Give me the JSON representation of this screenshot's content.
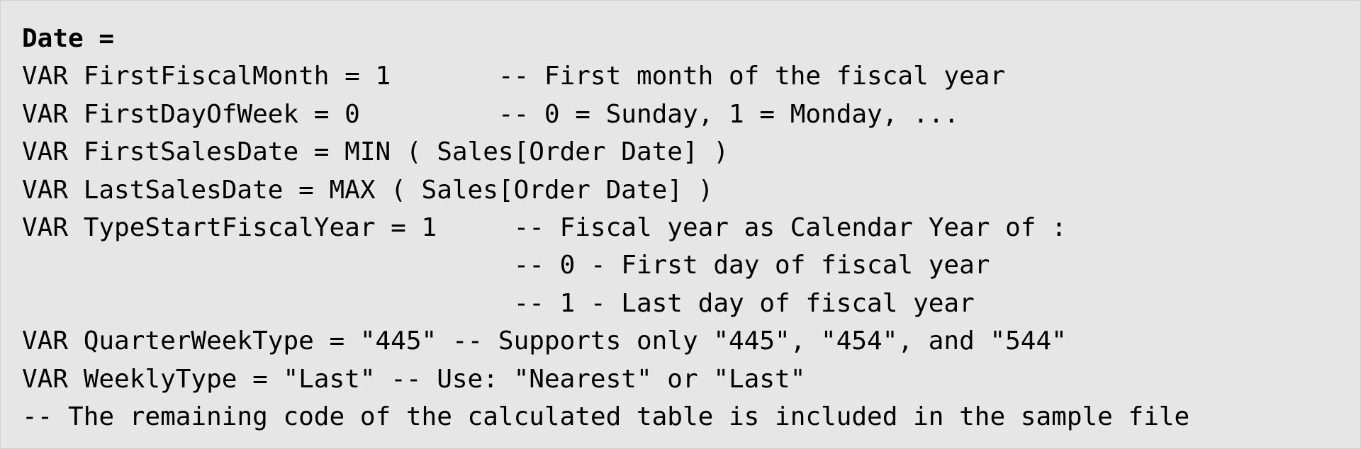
{
  "code": {
    "lines": [
      "Date =",
      "VAR FirstFiscalMonth = 1       -- First month of the fiscal year",
      "VAR FirstDayOfWeek = 0         -- 0 = Sunday, 1 = Monday, ...",
      "VAR FirstSalesDate = MIN ( Sales[Order Date] )",
      "VAR LastSalesDate = MAX ( Sales[Order Date] )",
      "VAR TypeStartFiscalYear = 1     -- Fiscal year as Calendar Year of :",
      "                                -- 0 - First day of fiscal year",
      "                                -- 1 - Last day of fiscal year",
      "VAR QuarterWeekType = \"445\" -- Supports only \"445\", \"454\", and \"544\"",
      "VAR WeeklyType = \"Last\" -- Use: \"Nearest\" or \"Last\"",
      "-- The remaining code of the calculated table is included in the sample file"
    ]
  },
  "colors": {
    "background": "#e6e6e6",
    "text": "#000000"
  }
}
